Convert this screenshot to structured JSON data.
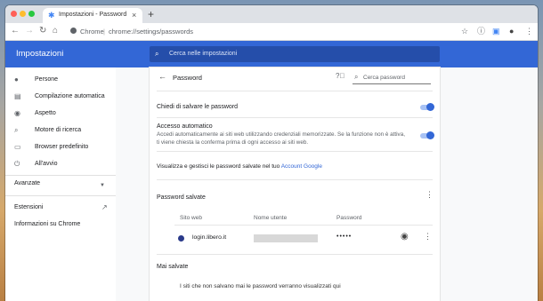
{
  "browser": {
    "tab_title": "Impostazioni - Password",
    "tab_close": "×",
    "new_tab": "+",
    "omnibox_origin": "Chrome",
    "omnibox_separator": "|",
    "omnibox_url": "chrome://settings/passwords",
    "icons": {
      "back": "←",
      "forward": "→",
      "reload": "↻",
      "home": "⌂",
      "star": "☆",
      "info": "ⓘ",
      "ext_badge": "0",
      "profile": "●",
      "menu": "⋮"
    }
  },
  "settings": {
    "app_title": "Impostazioni",
    "search_placeholder": "Cerca nelle impostazioni"
  },
  "sidebar": {
    "items": [
      {
        "label": "Persone",
        "icon": "person-icon"
      },
      {
        "label": "Compilazione automatica",
        "icon": "autofill-icon"
      },
      {
        "label": "Aspetto",
        "icon": "palette-icon"
      },
      {
        "label": "Motore di ricerca",
        "icon": "search-icon"
      },
      {
        "label": "Browser predefinito",
        "icon": "browser-icon"
      },
      {
        "label": "All'avvio",
        "icon": "power-icon"
      }
    ],
    "advanced": "Avanzate",
    "extensions": "Estensioni",
    "about": "Informazioni su Chrome"
  },
  "passwords": {
    "title": "Password",
    "search_placeholder": "Cerca password",
    "offer_save": "Chiedi di salvare le password",
    "auto_signin_title": "Accesso automatico",
    "auto_signin_desc_1": "Accedi automaticamente ai siti web utilizzando credenziali memorizzate. Se la funzione non è attiva,",
    "auto_signin_desc_2": "ti viene chiesta la conferma prima di ogni accesso ai siti web.",
    "manage_text": "Visualizza e gestisci le password salvate nel tuo ",
    "manage_link": "Account Google",
    "saved_title": "Password salvate",
    "columns": [
      "Sito web",
      "Nome utente",
      "Password"
    ],
    "rows": [
      {
        "site": "login.libero.it",
        "password_dots": "•••••"
      }
    ],
    "never_saved_title": "Mai salvate",
    "never_saved_desc": "I siti che non salvano mai le password verranno visualizzati qui"
  },
  "toggles": {
    "offer_save": true,
    "auto_signin": true
  },
  "colors": {
    "accent": "#3367d6",
    "toggle_track": "#a8c2f4"
  }
}
